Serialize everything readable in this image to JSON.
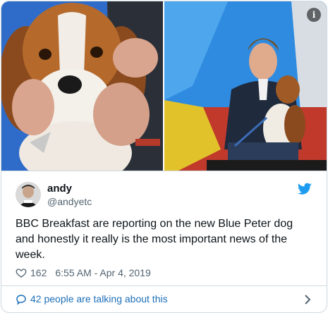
{
  "tweet": {
    "author_name": "andy",
    "author_handle": "@andyetc",
    "text": "BBC Breakfast are reporting on the new Blue Peter dog and honestly it really is the most important news of the week.",
    "like_count": "162",
    "timestamp": "6:55 AM - Apr 4, 2019",
    "conversation_label": "42 people are talking about this"
  },
  "icons": {
    "info": "info-icon",
    "brand": "twitter-bird-icon",
    "like": "heart-icon",
    "reply": "speech-bubble-icon",
    "more": "chevron-right-icon"
  },
  "colors": {
    "brand": "#1d9bf0",
    "link": "#1d6fb8",
    "text": "#0f1419",
    "muted": "#536471",
    "border": "#cfd9de"
  },
  "info_glyph": "i"
}
